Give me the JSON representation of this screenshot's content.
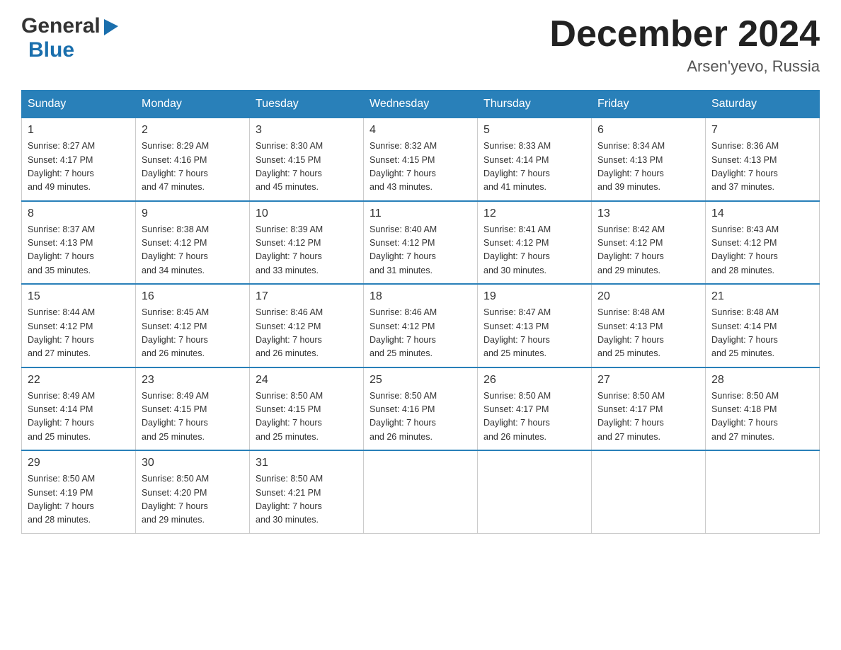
{
  "header": {
    "logo_general": "General",
    "logo_blue": "Blue",
    "month_title": "December 2024",
    "location": "Arsen'yevo, Russia"
  },
  "weekdays": [
    "Sunday",
    "Monday",
    "Tuesday",
    "Wednesday",
    "Thursday",
    "Friday",
    "Saturday"
  ],
  "weeks": [
    [
      {
        "day": "1",
        "sunrise": "8:27 AM",
        "sunset": "4:17 PM",
        "daylight": "7 hours and 49 minutes."
      },
      {
        "day": "2",
        "sunrise": "8:29 AM",
        "sunset": "4:16 PM",
        "daylight": "7 hours and 47 minutes."
      },
      {
        "day": "3",
        "sunrise": "8:30 AM",
        "sunset": "4:15 PM",
        "daylight": "7 hours and 45 minutes."
      },
      {
        "day": "4",
        "sunrise": "8:32 AM",
        "sunset": "4:15 PM",
        "daylight": "7 hours and 43 minutes."
      },
      {
        "day": "5",
        "sunrise": "8:33 AM",
        "sunset": "4:14 PM",
        "daylight": "7 hours and 41 minutes."
      },
      {
        "day": "6",
        "sunrise": "8:34 AM",
        "sunset": "4:13 PM",
        "daylight": "7 hours and 39 minutes."
      },
      {
        "day": "7",
        "sunrise": "8:36 AM",
        "sunset": "4:13 PM",
        "daylight": "7 hours and 37 minutes."
      }
    ],
    [
      {
        "day": "8",
        "sunrise": "8:37 AM",
        "sunset": "4:13 PM",
        "daylight": "7 hours and 35 minutes."
      },
      {
        "day": "9",
        "sunrise": "8:38 AM",
        "sunset": "4:12 PM",
        "daylight": "7 hours and 34 minutes."
      },
      {
        "day": "10",
        "sunrise": "8:39 AM",
        "sunset": "4:12 PM",
        "daylight": "7 hours and 33 minutes."
      },
      {
        "day": "11",
        "sunrise": "8:40 AM",
        "sunset": "4:12 PM",
        "daylight": "7 hours and 31 minutes."
      },
      {
        "day": "12",
        "sunrise": "8:41 AM",
        "sunset": "4:12 PM",
        "daylight": "7 hours and 30 minutes."
      },
      {
        "day": "13",
        "sunrise": "8:42 AM",
        "sunset": "4:12 PM",
        "daylight": "7 hours and 29 minutes."
      },
      {
        "day": "14",
        "sunrise": "8:43 AM",
        "sunset": "4:12 PM",
        "daylight": "7 hours and 28 minutes."
      }
    ],
    [
      {
        "day": "15",
        "sunrise": "8:44 AM",
        "sunset": "4:12 PM",
        "daylight": "7 hours and 27 minutes."
      },
      {
        "day": "16",
        "sunrise": "8:45 AM",
        "sunset": "4:12 PM",
        "daylight": "7 hours and 26 minutes."
      },
      {
        "day": "17",
        "sunrise": "8:46 AM",
        "sunset": "4:12 PM",
        "daylight": "7 hours and 26 minutes."
      },
      {
        "day": "18",
        "sunrise": "8:46 AM",
        "sunset": "4:12 PM",
        "daylight": "7 hours and 25 minutes."
      },
      {
        "day": "19",
        "sunrise": "8:47 AM",
        "sunset": "4:13 PM",
        "daylight": "7 hours and 25 minutes."
      },
      {
        "day": "20",
        "sunrise": "8:48 AM",
        "sunset": "4:13 PM",
        "daylight": "7 hours and 25 minutes."
      },
      {
        "day": "21",
        "sunrise": "8:48 AM",
        "sunset": "4:14 PM",
        "daylight": "7 hours and 25 minutes."
      }
    ],
    [
      {
        "day": "22",
        "sunrise": "8:49 AM",
        "sunset": "4:14 PM",
        "daylight": "7 hours and 25 minutes."
      },
      {
        "day": "23",
        "sunrise": "8:49 AM",
        "sunset": "4:15 PM",
        "daylight": "7 hours and 25 minutes."
      },
      {
        "day": "24",
        "sunrise": "8:50 AM",
        "sunset": "4:15 PM",
        "daylight": "7 hours and 25 minutes."
      },
      {
        "day": "25",
        "sunrise": "8:50 AM",
        "sunset": "4:16 PM",
        "daylight": "7 hours and 26 minutes."
      },
      {
        "day": "26",
        "sunrise": "8:50 AM",
        "sunset": "4:17 PM",
        "daylight": "7 hours and 26 minutes."
      },
      {
        "day": "27",
        "sunrise": "8:50 AM",
        "sunset": "4:17 PM",
        "daylight": "7 hours and 27 minutes."
      },
      {
        "day": "28",
        "sunrise": "8:50 AM",
        "sunset": "4:18 PM",
        "daylight": "7 hours and 27 minutes."
      }
    ],
    [
      {
        "day": "29",
        "sunrise": "8:50 AM",
        "sunset": "4:19 PM",
        "daylight": "7 hours and 28 minutes."
      },
      {
        "day": "30",
        "sunrise": "8:50 AM",
        "sunset": "4:20 PM",
        "daylight": "7 hours and 29 minutes."
      },
      {
        "day": "31",
        "sunrise": "8:50 AM",
        "sunset": "4:21 PM",
        "daylight": "7 hours and 30 minutes."
      },
      null,
      null,
      null,
      null
    ]
  ],
  "labels": {
    "sunrise": "Sunrise:",
    "sunset": "Sunset:",
    "daylight": "Daylight:"
  }
}
